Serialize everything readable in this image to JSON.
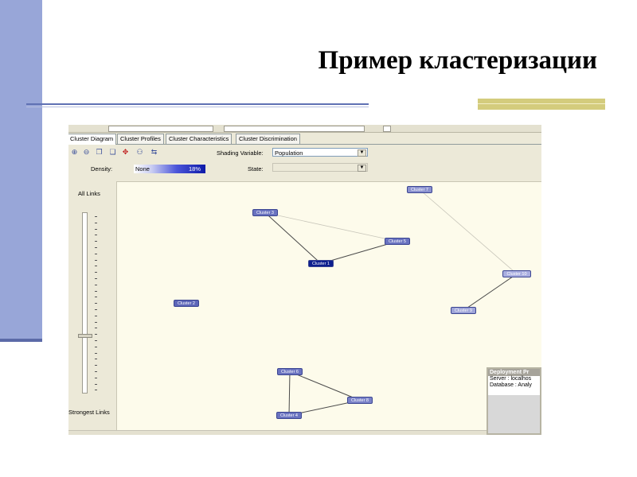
{
  "slide": {
    "title": "Пример кластеризации"
  },
  "colors": {
    "left_band": "#98a6d8",
    "rule_blue": "#5f71b3",
    "rule_gold": "#d4cc7d",
    "canvas_bg": "#fdfbeb"
  },
  "app": {
    "tabs": [
      {
        "label": "Cluster Diagram",
        "active": true
      },
      {
        "label": "Cluster Profiles",
        "active": false
      },
      {
        "label": "Cluster Characteristics",
        "active": false
      },
      {
        "label": "Cluster Discrimination",
        "active": false
      }
    ],
    "toolbar_icons": [
      "zoom-in-icon",
      "zoom-out-icon",
      "copy-icon",
      "copy-graph-icon",
      "fit-icon",
      "layout-icon",
      "legend-icon"
    ],
    "shading_variable": {
      "label": "Shading Variable:",
      "value": "Population"
    },
    "state": {
      "label": "State:",
      "value": ""
    },
    "density": {
      "label": "Density:",
      "min_label": "None",
      "value": "18%"
    },
    "slider": {
      "top_label": "All Links",
      "bottom_label": "Strongest Links",
      "position_fraction": 0.69
    },
    "clusters": [
      {
        "id": "c1",
        "label": "Cluster 1",
        "shade": "#0d1f8e"
      },
      {
        "id": "c2",
        "label": "Cluster 2",
        "shade": "#5d66b8"
      },
      {
        "id": "c3",
        "label": "Cluster 3",
        "shade": "#6a73c0"
      },
      {
        "id": "c4",
        "label": "Cluster 4",
        "shade": "#6a73c0"
      },
      {
        "id": "c5",
        "label": "Cluster 5",
        "shade": "#6a73c0"
      },
      {
        "id": "c6",
        "label": "Cluster 6",
        "shade": "#6a73c0"
      },
      {
        "id": "c7",
        "label": "Cluster 7",
        "shade": "#8a91cf"
      },
      {
        "id": "c8",
        "label": "Cluster 8",
        "shade": "#7a82c8"
      },
      {
        "id": "c9",
        "label": "Cluster 9",
        "shade": "#9ea4d8"
      },
      {
        "id": "c10",
        "label": "Cluster 10",
        "shade": "#a9aee0"
      }
    ],
    "links": [
      {
        "from": "c3",
        "to": "c1",
        "strength": "strong"
      },
      {
        "from": "c1",
        "to": "c5",
        "strength": "strong"
      },
      {
        "from": "c3",
        "to": "c5",
        "strength": "weak"
      },
      {
        "from": "c7",
        "to": "c10",
        "strength": "weak"
      },
      {
        "from": "c10",
        "to": "c9",
        "strength": "strong"
      },
      {
        "from": "c6",
        "to": "c4",
        "strength": "strong"
      },
      {
        "from": "c6",
        "to": "c8",
        "strength": "strong"
      },
      {
        "from": "c4",
        "to": "c8",
        "strength": "strong"
      }
    ],
    "deployment": {
      "title": "Deployment Pr",
      "server": "Server :  localhos",
      "database": "Database : Analy"
    }
  }
}
